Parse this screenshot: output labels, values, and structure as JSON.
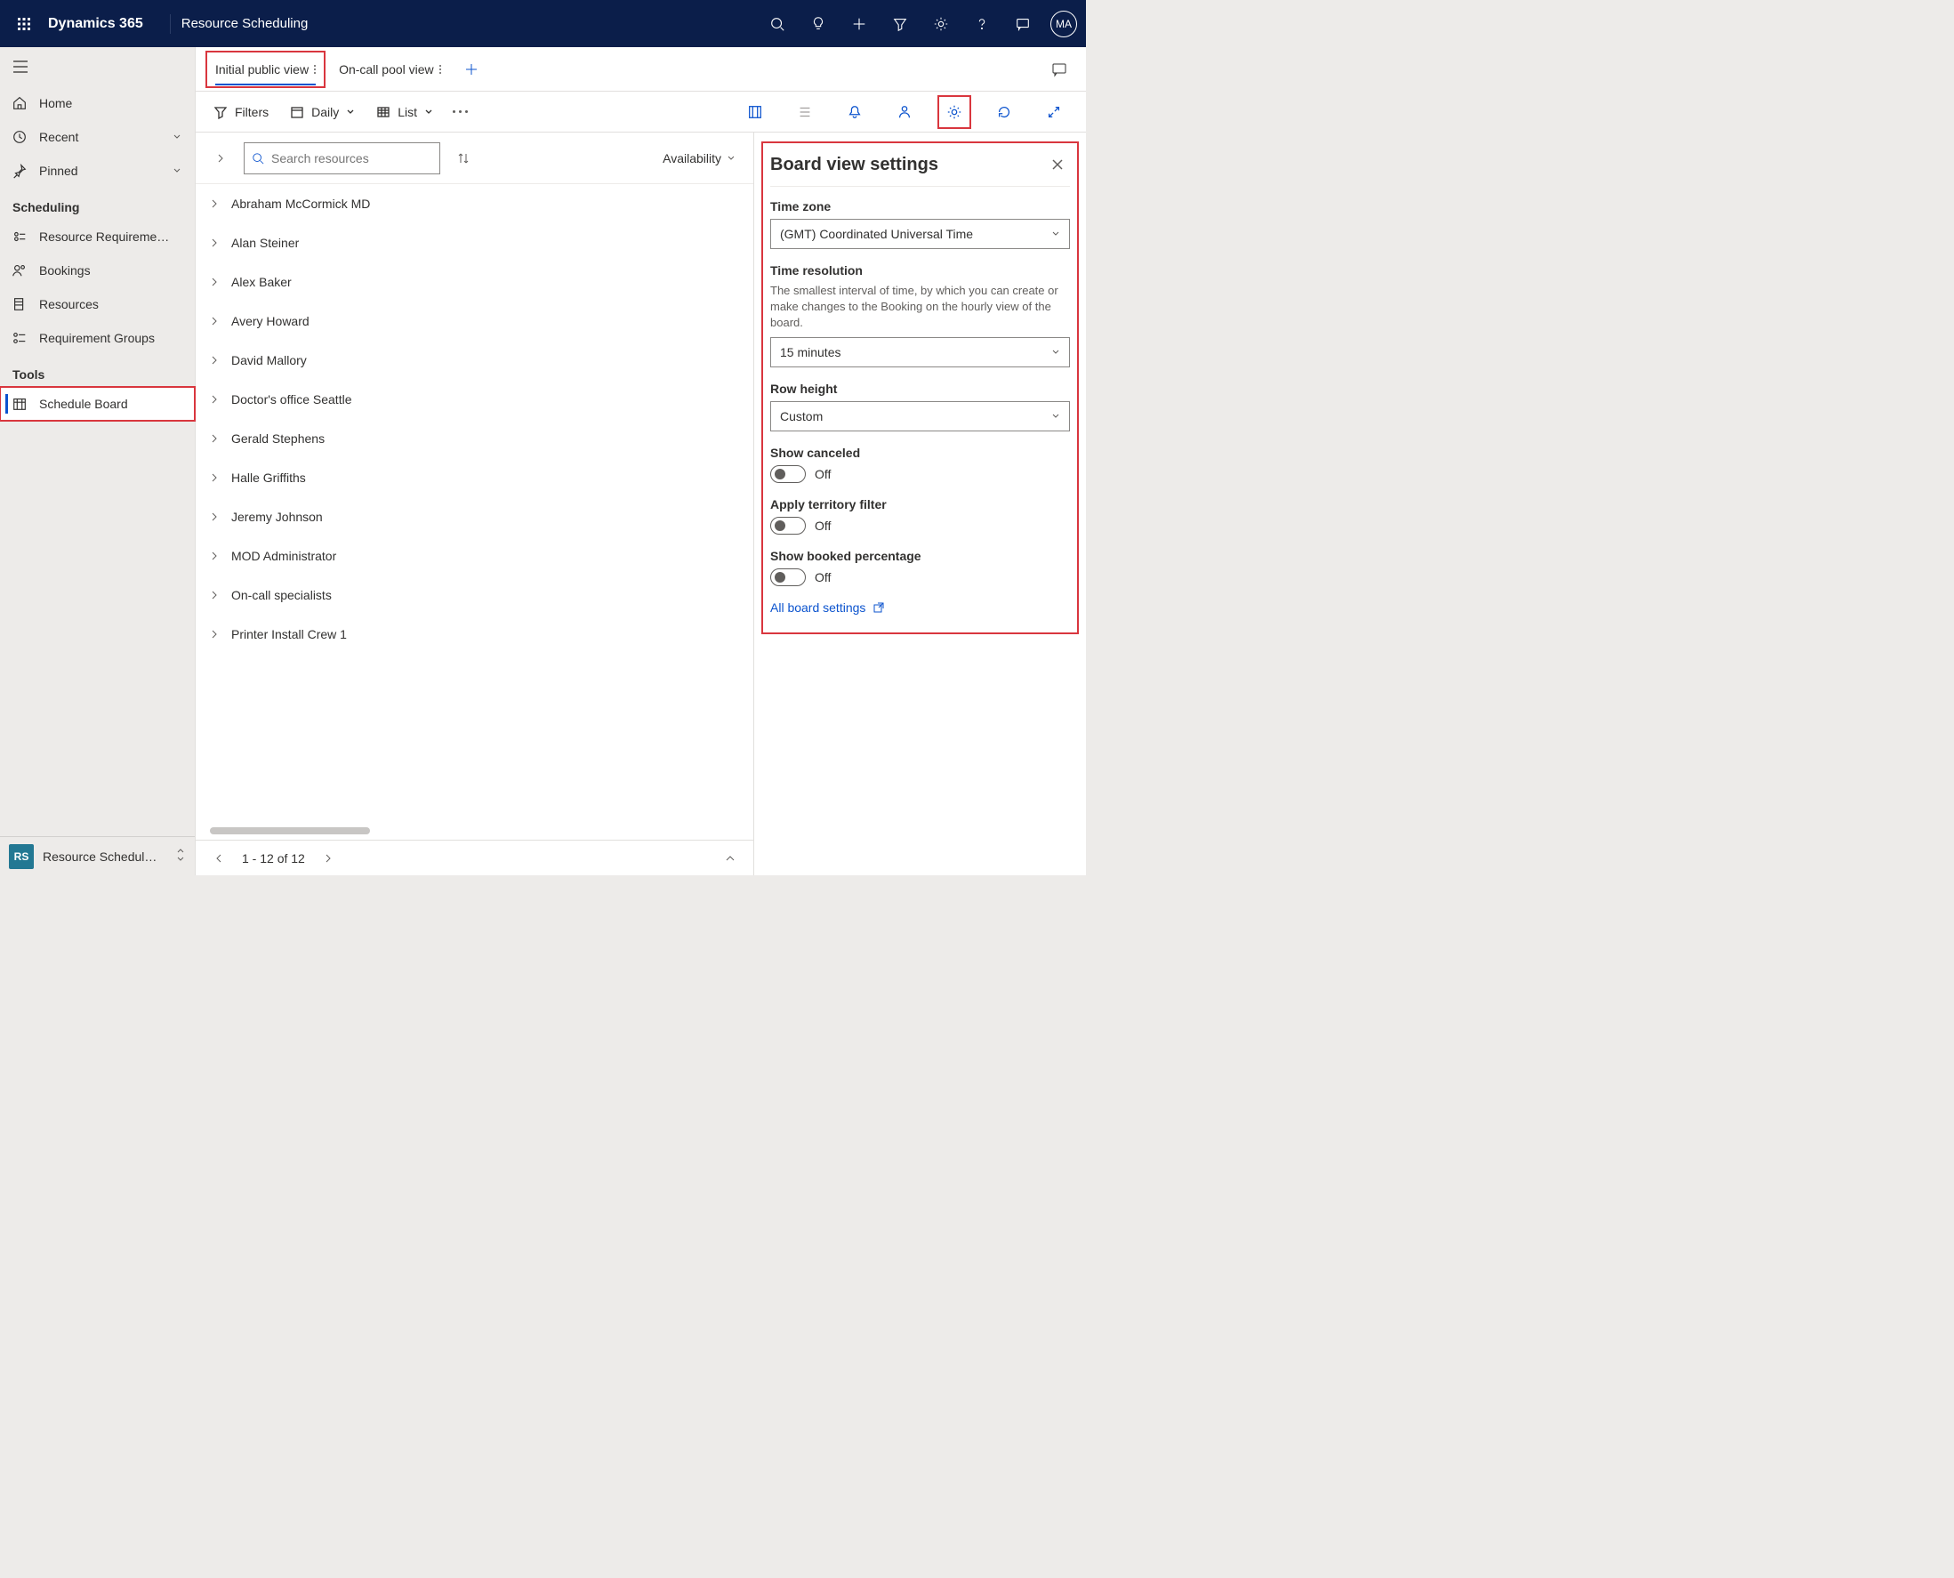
{
  "header": {
    "brand": "Dynamics 365",
    "appname": "Resource Scheduling",
    "avatar": "MA"
  },
  "sidebar": {
    "items": [
      {
        "label": "Home"
      },
      {
        "label": "Recent"
      },
      {
        "label": "Pinned"
      }
    ],
    "scheduling_group": "Scheduling",
    "scheduling_items": [
      {
        "label": "Resource Requireme…"
      },
      {
        "label": "Bookings"
      },
      {
        "label": "Resources"
      },
      {
        "label": "Requirement Groups"
      }
    ],
    "tools_group": "Tools",
    "tools_items": [
      {
        "label": "Schedule Board"
      }
    ],
    "footer": {
      "badge": "RS",
      "label": "Resource Schedul…"
    }
  },
  "tabs": [
    {
      "label": "Initial public view",
      "active": true
    },
    {
      "label": "On-call pool view",
      "active": false
    }
  ],
  "toolbar": {
    "filters": "Filters",
    "daily": "Daily",
    "list": "List"
  },
  "searchrow": {
    "placeholder": "Search resources",
    "availability": "Availability"
  },
  "resources": [
    "Abraham McCormick MD",
    "Alan Steiner",
    "Alex Baker",
    "Avery Howard",
    "David Mallory",
    "Doctor's office Seattle",
    "Gerald Stephens",
    "Halle Griffiths",
    "Jeremy Johnson",
    "MOD Administrator",
    "On-call specialists",
    "Printer Install Crew 1"
  ],
  "pager": {
    "range": "1 - 12 of 12"
  },
  "settings": {
    "title": "Board view settings",
    "timezone": {
      "label": "Time zone",
      "value": "(GMT) Coordinated Universal Time"
    },
    "resolution": {
      "label": "Time resolution",
      "desc": "The smallest interval of time, by which you can create or make changes to the Booking on the hourly view of the board.",
      "value": "15 minutes"
    },
    "rowheight": {
      "label": "Row height",
      "value": "Custom"
    },
    "canceled": {
      "label": "Show canceled",
      "state": "Off"
    },
    "territory": {
      "label": "Apply territory filter",
      "state": "Off"
    },
    "booked": {
      "label": "Show booked percentage",
      "state": "Off"
    },
    "allsettings": "All board settings"
  }
}
